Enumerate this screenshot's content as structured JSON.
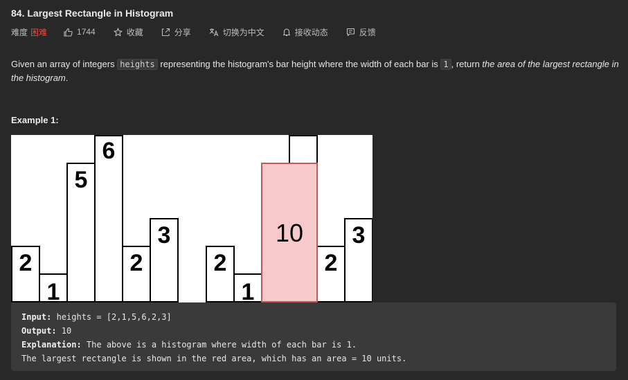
{
  "problem": {
    "title": "84. Largest Rectangle in Histogram",
    "difficulty_label": "难度",
    "difficulty_value": "困难",
    "difficulty_color": "#ef4743",
    "likes": "1744",
    "actions": [
      {
        "label": "收藏",
        "icon": "star-icon"
      },
      {
        "label": "分享",
        "icon": "share-icon"
      },
      {
        "label": "切换为中文",
        "icon": "translate-icon"
      },
      {
        "label": "接收动态",
        "icon": "bell-icon"
      },
      {
        "label": "反馈",
        "icon": "feedback-icon"
      }
    ]
  },
  "description": {
    "part1": "Given an array of integers ",
    "code1": "heights",
    "part2": " representing the histogram's bar height where the width of each bar is ",
    "code2": "1",
    "part3": ", return ",
    "emphasis": "the area of the largest rectangle in the histogram",
    "part4": "."
  },
  "example": {
    "title": "Example 1:",
    "input_label": "Input:",
    "input_value": " heights = [2,1,5,6,2,3]",
    "output_label": "Output:",
    "output_value": " 10",
    "explanation_label": "Explanation:",
    "explanation_value": " The above is a histogram where width of each bar is 1.",
    "explanation_line2": "The largest rectangle is shown in the red area, which has an area = 10 units."
  },
  "histogram": {
    "heights": [
      2,
      1,
      5,
      6,
      2,
      3
    ],
    "max_rectangle": {
      "start_index": 2,
      "end_index": 3,
      "height": 5,
      "area": "10"
    },
    "highlight_fill": "#f6caca",
    "highlight_stroke": "#b85c5c"
  }
}
